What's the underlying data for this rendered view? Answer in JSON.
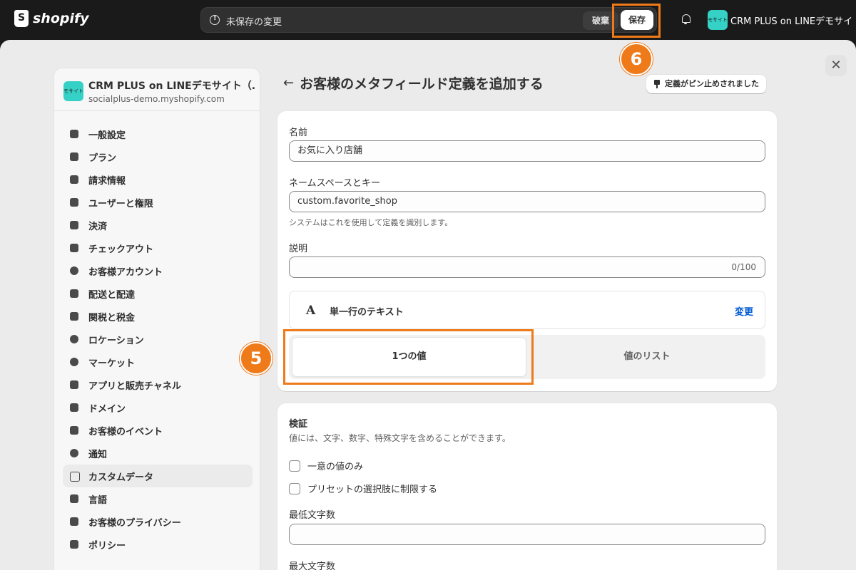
{
  "topbar": {
    "logo_text": "shopify",
    "unsaved_text": "未保存の変更",
    "discard_label": "破棄",
    "save_label": "保存",
    "store_avatar_text": "モサイト",
    "store_name": "CRM PLUS on LINEデモサイ..."
  },
  "sidebar": {
    "store_avatar_text": "モサイト",
    "store_name": "CRM PLUS on LINEデモサイト（...",
    "store_url": "socialplus-demo.myshopify.com",
    "items": [
      {
        "label": "一般設定",
        "icon": "store-icon"
      },
      {
        "label": "プラン",
        "icon": "plan-icon"
      },
      {
        "label": "請求情報",
        "icon": "billing-icon"
      },
      {
        "label": "ユーザーと権限",
        "icon": "users-icon"
      },
      {
        "label": "決済",
        "icon": "payments-icon"
      },
      {
        "label": "チェックアウト",
        "icon": "cart-icon"
      },
      {
        "label": "お客様アカウント",
        "icon": "person-icon"
      },
      {
        "label": "配送と配達",
        "icon": "truck-icon"
      },
      {
        "label": "関税と税金",
        "icon": "tax-icon"
      },
      {
        "label": "ロケーション",
        "icon": "location-icon"
      },
      {
        "label": "マーケット",
        "icon": "globe-icon"
      },
      {
        "label": "アプリと販売チャネル",
        "icon": "apps-icon"
      },
      {
        "label": "ドメイン",
        "icon": "domain-icon"
      },
      {
        "label": "お客様のイベント",
        "icon": "events-icon"
      },
      {
        "label": "通知",
        "icon": "bell-icon"
      },
      {
        "label": "カスタムデータ",
        "icon": "custom-data-icon"
      },
      {
        "label": "言語",
        "icon": "language-icon"
      },
      {
        "label": "お客様のプライバシー",
        "icon": "lock-icon"
      },
      {
        "label": "ポリシー",
        "icon": "policy-icon"
      }
    ],
    "active_index": 15
  },
  "page": {
    "title": "お客様のメタフィールド定義を追加する",
    "pin_label": "定義がピン止めされました"
  },
  "form": {
    "name_label": "名前",
    "name_value": "お気に入り店舗",
    "key_label": "ネームスペースとキー",
    "key_value": "custom.favorite_shop",
    "key_help": "システムはこれを使用して定義を識別します。",
    "desc_label": "説明",
    "desc_value": "",
    "desc_counter": "0/100",
    "type_icon_text": "A",
    "type_label": "単一行のテキスト",
    "type_change": "変更",
    "seg_one": "1つの値",
    "seg_list": "値のリスト"
  },
  "validation": {
    "title": "検証",
    "description": "値には、文字、数字、特殊文字を含めることができます。",
    "unique_label": "一意の値のみ",
    "preset_label": "プリセットの選択肢に制限する",
    "min_label": "最低文字数",
    "max_label": "最大文字数"
  },
  "annotations": {
    "badge5": "5",
    "badge6": "6",
    "highlight_color": "#ef7a1a"
  }
}
